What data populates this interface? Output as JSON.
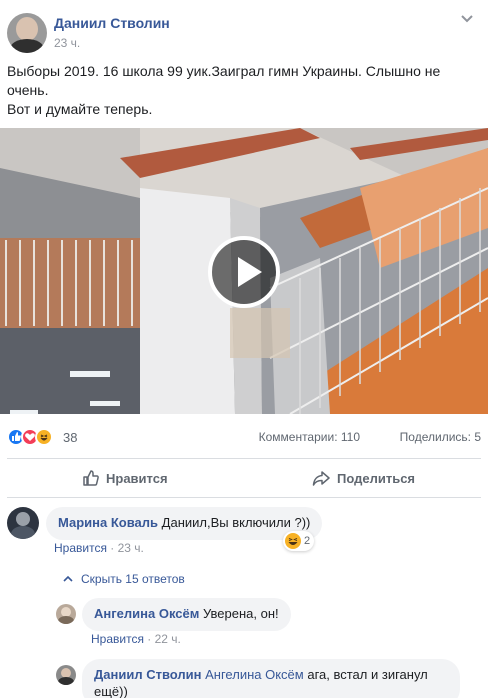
{
  "post": {
    "author": "Даниил Стволин",
    "time": "23 ч.",
    "text_line1": "Выборы 2019. 16 школа 99 уик.Заиграл гимн Украины. Слышно не",
    "text_line2": "очень.",
    "text_line3": "Вот и думайте теперь."
  },
  "reactions": {
    "icons": [
      "like-icon",
      "love-icon",
      "haha-icon"
    ],
    "count": "38",
    "comments": "Комментарии: 110",
    "shares": "Поделились: 5"
  },
  "actions": {
    "like_label": "Нравится",
    "share_label": "Поделиться"
  },
  "comments": [
    {
      "author": "Марина Коваль",
      "text": "Даниил,Вы включили ?))",
      "like_label": "Нравится",
      "time": "23 ч.",
      "reaction_icon": "haha-icon",
      "reaction_count": "2"
    }
  ],
  "replies_toggle": "Скрыть 15 ответов",
  "replies": [
    {
      "author": "Ангелина Оксём",
      "text": "Уверена, он!",
      "like_label": "Нравится",
      "time": "22 ч."
    },
    {
      "author": "Даниил Стволин",
      "mention": "Ангелина Оксём",
      "text": "ага, встал и зиганул",
      "text2": "ещё))"
    }
  ],
  "colors": {
    "link": "#385898",
    "muted": "#90949c",
    "like": "#1877f2",
    "love": "#f33e58",
    "haha": "#f7b125"
  }
}
